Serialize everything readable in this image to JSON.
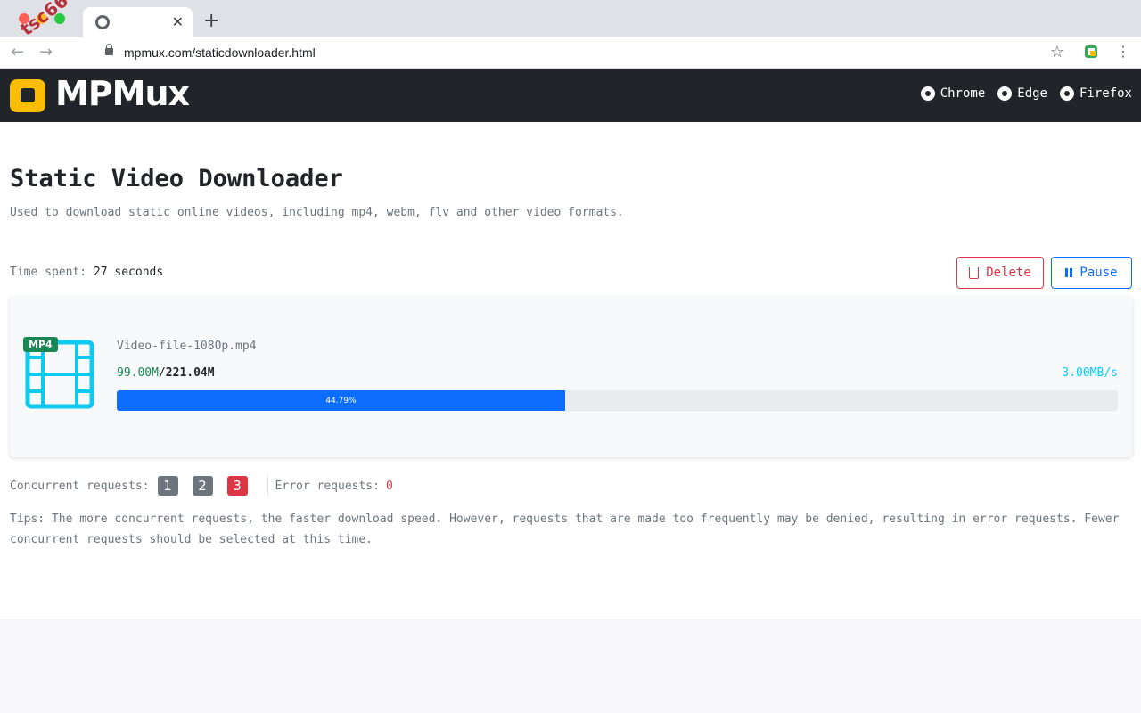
{
  "browser": {
    "tab_close": "✕",
    "new_tab": "+",
    "url": "mpmux.com/staticdownloader.html",
    "watermark": "tsc66"
  },
  "header": {
    "logo_text": "MPMux",
    "browsers": [
      {
        "label": "Chrome"
      },
      {
        "label": "Edge"
      },
      {
        "label": "Firefox"
      }
    ]
  },
  "page": {
    "title": "Static Video Downloader",
    "subtitle": "Used to download static online videos, including mp4, webm, flv and other video formats."
  },
  "status": {
    "time_label": "Time spent: ",
    "time_value": "27 seconds"
  },
  "actions": {
    "delete_label": "Delete",
    "pause_label": "Pause"
  },
  "download": {
    "format_badge": "MP4",
    "file_name": "Video-file-1080p.mp4",
    "downloaded": "99.00M",
    "separator": "/",
    "total": "221.04M",
    "speed": "3.00MB/s",
    "progress_label": "44.79%",
    "progress_fraction": 0.4479
  },
  "concurrency": {
    "label": "Concurrent requests:",
    "options": [
      "1",
      "2",
      "3"
    ],
    "selected": "3",
    "error_label": "Error requests:",
    "error_value": "0"
  },
  "tips": "Tips: The more concurrent requests, the faster download speed. However, requests that are made too frequently may be denied, resulting in error requests. Fewer concurrent requests should be selected at this time.",
  "colors": {
    "brand": "#fbbc04",
    "header_bg": "#212529",
    "primary": "#0d6efd",
    "danger": "#dc3545",
    "success": "#198754",
    "info": "#0dcaf0"
  }
}
